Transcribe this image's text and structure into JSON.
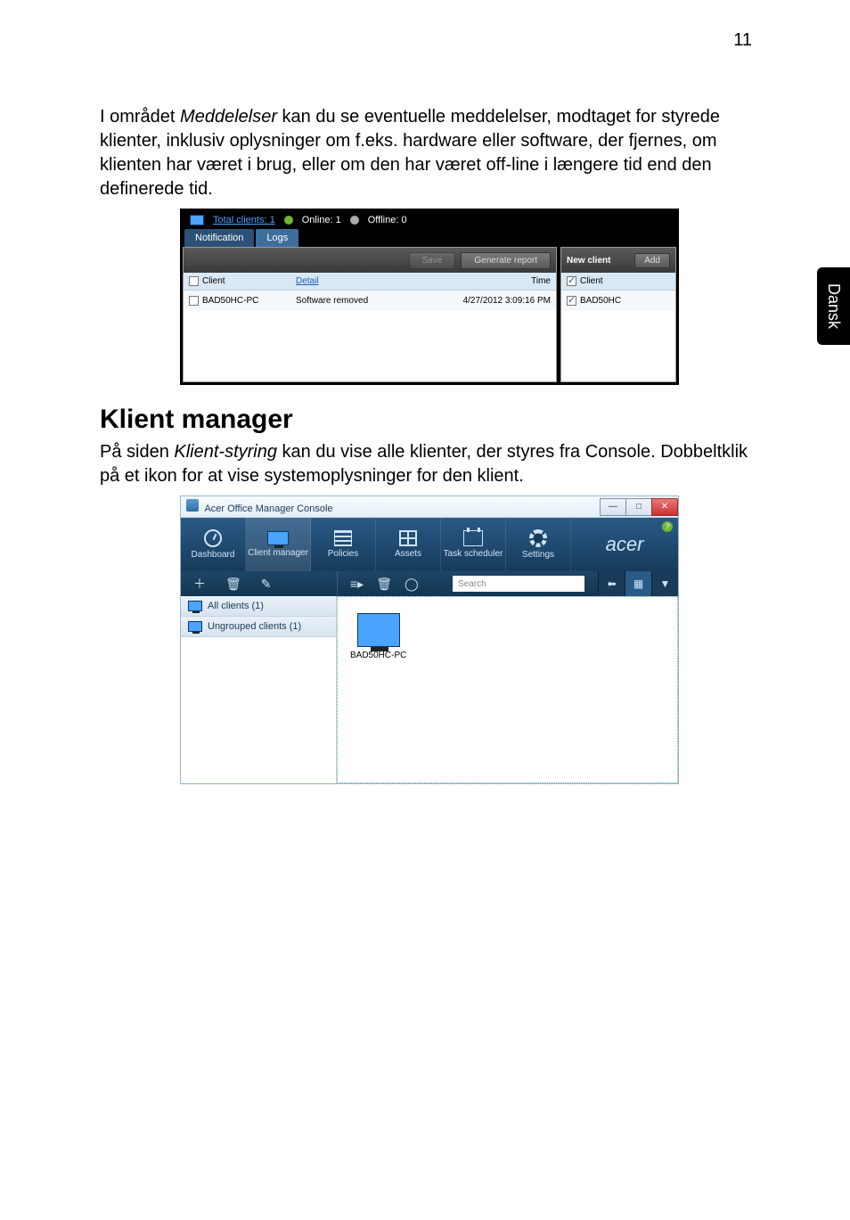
{
  "page_number": "11",
  "side_tab": "Dansk",
  "intro_parts": [
    "I området ",
    "Meddelelser",
    " kan du se eventuelle meddelelser, modtaget for styrede klienter, inklusiv oplysninger om f.eks. hardware eller software, der fjernes, om klienten har været i brug, eller om den har været off-line i længere tid end den definerede tid."
  ],
  "heading": "Klient manager",
  "para2_parts": [
    "På siden ",
    "Klient-styring",
    " kan du vise alle klienter, der styres fra Console. Dobbeltklik på et ikon for at vise systemoplysninger for den klient."
  ],
  "shot1": {
    "top": {
      "total_link_label": "Total clients: 1",
      "online_label": "Online: 1",
      "offline_label": "Offline: 0"
    },
    "tabs": {
      "notification": "Notification",
      "logs": "Logs"
    },
    "toolbar": {
      "save": "Save",
      "generate": "Generate report"
    },
    "right_toolbar": {
      "title": "New client",
      "add": "Add"
    },
    "cols": {
      "client": "Client",
      "detail": "Detail",
      "time": "Time"
    },
    "right_col": "Client",
    "row": {
      "client": "BAD50HC-PC",
      "detail": "Software removed",
      "time": "4/27/2012 3:09:16 PM"
    },
    "right_row": "BAD50HC"
  },
  "shot2": {
    "title": "Acer Office Manager Console",
    "nav": {
      "dashboard": "Dashboard",
      "client_manager": "Client manager",
      "policies": "Policies",
      "assets": "Assets",
      "task_scheduler": "Task scheduler",
      "settings": "Settings"
    },
    "brand": "acer",
    "search_placeholder": "Search",
    "side": {
      "all": "All clients (1)",
      "ungrouped": "Ungrouped clients (1)"
    },
    "grid_item": "BAD50HC-PC",
    "winbtns": {
      "min": "—",
      "max": "□",
      "close": "✕"
    },
    "help": "?"
  }
}
